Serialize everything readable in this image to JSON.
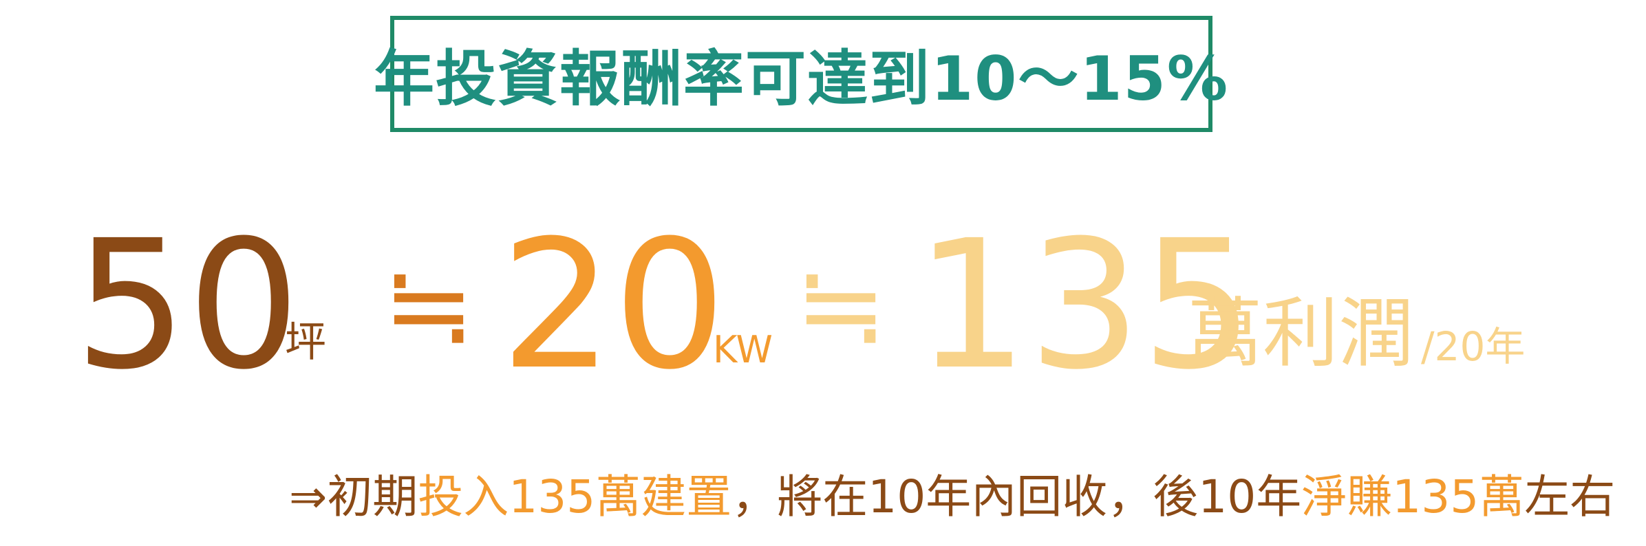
{
  "title": {
    "text": "年投資報酬率可達到10～15%"
  },
  "equation": {
    "area_value": "50",
    "area_unit": "坪",
    "approx_symbol": "≒",
    "capacity_value": "20",
    "capacity_unit": "KW",
    "profit_value": "135",
    "profit_label": "萬利潤",
    "profit_period": "/20年"
  },
  "summary": {
    "arrow": "⇒",
    "part1": "初期",
    "part2": "投入135萬建置",
    "part3": "，將在10年內回收，後10年",
    "part4": "淨賺135萬",
    "part5": "左右"
  },
  "colors": {
    "title_border": "#1f8a67",
    "title_text": "#1f8f7f",
    "brown": "#8b4a16",
    "dark_orange": "#d97a1f",
    "orange": "#f39a2e",
    "light_orange": "#f8d38a"
  }
}
